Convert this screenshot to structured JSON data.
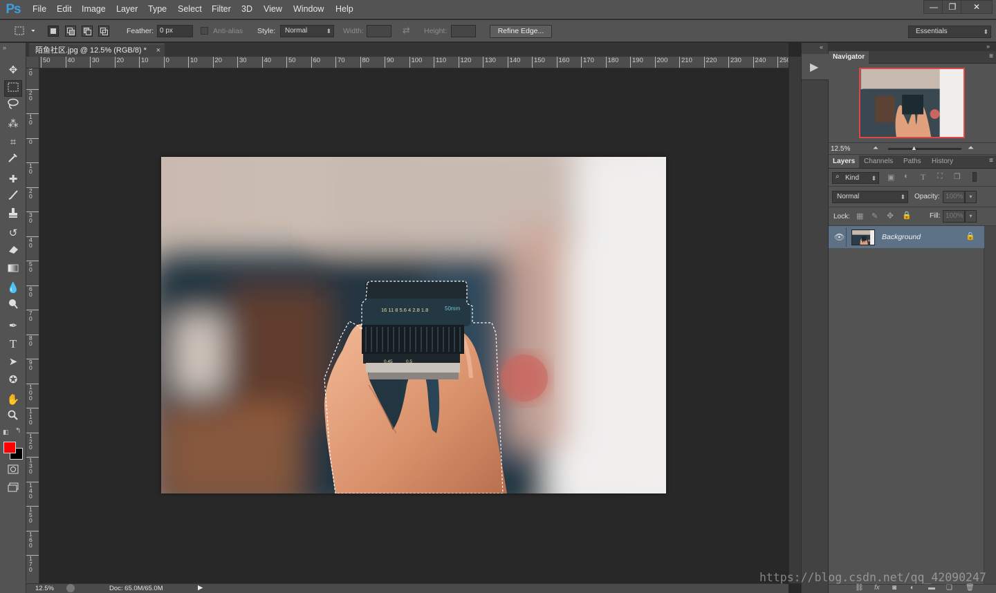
{
  "app": {
    "logo": "Ps"
  },
  "menu": [
    "File",
    "Edit",
    "Image",
    "Layer",
    "Type",
    "Select",
    "Filter",
    "3D",
    "View",
    "Window",
    "Help"
  ],
  "window_controls": {
    "minimize": "—",
    "restore": "❐",
    "close": "✕"
  },
  "options_bar": {
    "feather_label": "Feather:",
    "feather_value": "0 px",
    "antialias_label": "Anti-alias",
    "style_label": "Style:",
    "style_value": "Normal",
    "width_label": "Width:",
    "height_label": "Height:",
    "refine_edge_label": "Refine Edge...",
    "workspace_value": "Essentials"
  },
  "document": {
    "tab_title": "陌鱼社区.jpg @ 12.5% (RGB/8) *",
    "close_glyph": "×",
    "zoom": "12.5%",
    "doc_size": "Doc: 65.0M/65.0M"
  },
  "rulers": {
    "horizontal": [
      "50",
      "40",
      "30",
      "20",
      "10",
      "0",
      "10",
      "20",
      "30",
      "40",
      "50",
      "60",
      "70",
      "80",
      "90",
      "100",
      "110",
      "120",
      "130",
      "140",
      "150",
      "160",
      "170",
      "180",
      "190",
      "200",
      "210",
      "220",
      "230",
      "240",
      "250"
    ],
    "vertical": [
      "3\n0",
      "2\n0",
      "1\n0",
      "0",
      "1\n0",
      "2\n0",
      "3\n0",
      "4\n0",
      "5\n0",
      "6\n0",
      "7\n0",
      "8\n0",
      "9\n0",
      "1\n0\n0",
      "1\n1\n0",
      "1\n2\n0",
      "1\n3\n0",
      "1\n4\n0",
      "1\n5\n0",
      "1\n6\n0",
      "1\n7\n0"
    ]
  },
  "lens_text": {
    "scale": "16 11 8 5.6 4 2.8 1.8",
    "focal": "50mm",
    "dist1": "0.45",
    "dist2": "0.5"
  },
  "navigator": {
    "title": "Navigator",
    "zoom": "12.5%"
  },
  "layers_panel": {
    "tabs": [
      "Layers",
      "Channels",
      "Paths",
      "History"
    ],
    "kind_label": "Kind",
    "blend_mode": "Normal",
    "opacity_label": "Opacity:",
    "opacity_value": "100%",
    "lock_label": "Lock:",
    "fill_label": "Fill:",
    "fill_value": "100%",
    "layers": [
      {
        "name": "Background"
      }
    ]
  },
  "colors": {
    "foreground": "#ff0000",
    "background": "#000000",
    "accent": "#3b9fe0"
  },
  "watermark": "https://blog.csdn.net/qq_42090247"
}
